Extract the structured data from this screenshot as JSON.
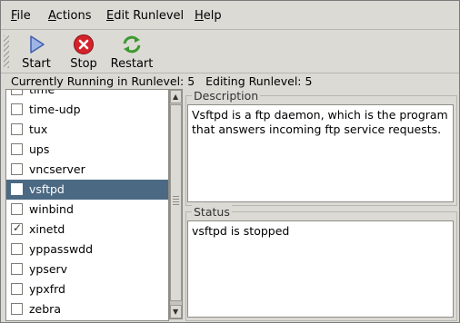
{
  "menubar": {
    "items": [
      {
        "label": "File",
        "mnemonic": "F",
        "rest": "ile"
      },
      {
        "label": "Actions",
        "mnemonic": "A",
        "rest": "ctions"
      },
      {
        "label": "Edit Runlevel",
        "mnemonic": "E",
        "rest": "dit Runlevel"
      },
      {
        "label": "Help",
        "mnemonic": "H",
        "rest": "elp"
      }
    ]
  },
  "toolbar": {
    "start_label": "Start",
    "stop_label": "Stop",
    "restart_label": "Restart"
  },
  "status": {
    "running": "Currently Running in Runlevel: 5",
    "editing": "Editing Runlevel: 5"
  },
  "services": [
    {
      "name": "time",
      "checked": false,
      "selected": false
    },
    {
      "name": "time-udp",
      "checked": false,
      "selected": false
    },
    {
      "name": "tux",
      "checked": false,
      "selected": false
    },
    {
      "name": "ups",
      "checked": false,
      "selected": false
    },
    {
      "name": "vncserver",
      "checked": false,
      "selected": false
    },
    {
      "name": "vsftpd",
      "checked": false,
      "selected": true
    },
    {
      "name": "winbind",
      "checked": false,
      "selected": false
    },
    {
      "name": "xinetd",
      "checked": true,
      "selected": false
    },
    {
      "name": "yppasswdd",
      "checked": false,
      "selected": false
    },
    {
      "name": "ypserv",
      "checked": false,
      "selected": false
    },
    {
      "name": "ypxfrd",
      "checked": false,
      "selected": false
    },
    {
      "name": "zebra",
      "checked": false,
      "selected": false
    }
  ],
  "description": {
    "title": "Description",
    "text": "Vsftpd is a ftp daemon, which is the program that answers incoming ftp service requests."
  },
  "status_panel": {
    "title": "Status",
    "text": "vsftpd is stopped"
  },
  "colors": {
    "selection": "#4b6983",
    "window_bg": "#dcdad5",
    "stop_red": "#d4232b",
    "start_blue": "#3e5fb0",
    "restart_green": "#3c9a2f"
  },
  "icons": {
    "start": "play-icon",
    "stop": "stop-icon",
    "restart": "refresh-icon"
  }
}
